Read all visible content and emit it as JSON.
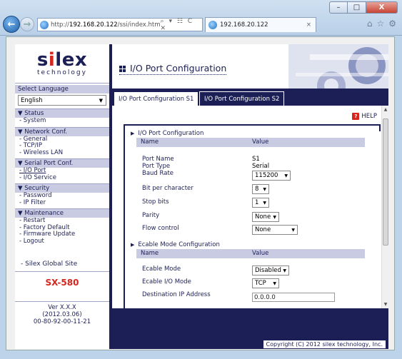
{
  "browser": {
    "url_prefix": "http://",
    "url_host": "192.168.20.122",
    "url_path": "/ssi/index.htm",
    "address_tools": "⌕ ▾ ☷ C ✕",
    "tab_title": "192.168.20.122",
    "tab_close": "×",
    "back": "←",
    "forward": "→",
    "min": "–",
    "max": "□",
    "close": "X",
    "icons": [
      "home-icon",
      "star-icon",
      "gear-icon"
    ]
  },
  "logo": {
    "main_pre": "s",
    "main_i": "i",
    "main_post": "lex",
    "sub": "technology"
  },
  "nav": {
    "language_title": "Select Language",
    "language_value": "English",
    "groups": [
      {
        "title": "▼ Status",
        "items": [
          "- System"
        ]
      },
      {
        "title": "▼ Network Conf.",
        "items": [
          "- General",
          "- TCP/IP",
          "- Wireless LAN"
        ]
      },
      {
        "title": "▼ Serial Port Conf.",
        "items": [
          "- I/O Port",
          "- I/O Service"
        ]
      },
      {
        "title": "▼ Security",
        "items": [
          "- Password",
          "- IP Filter"
        ]
      },
      {
        "title": "▼ Maintenance",
        "items": [
          "- Restart",
          "- Factory Default",
          "- Firmware Update",
          "- Logout"
        ]
      }
    ],
    "global_site": "- Silex Global Site",
    "model": "SX-580",
    "version_lines": [
      "Ver X.X.X",
      "(2012.03.06)",
      "00-80-92-00-11-21"
    ]
  },
  "main": {
    "title": "I/O Port Configuration",
    "tabs": [
      "I/O Port Configuration S1",
      "I/O Port Configuration S2"
    ],
    "help": "HELP",
    "section1": {
      "heading": "I/O Port Configuration",
      "col_name": "Name",
      "col_value": "Value",
      "port_name_label": "Port Name",
      "port_name_value": "S1",
      "port_type_label": "Port Type",
      "port_type_value": "Serial",
      "baud_label": "Baud Rate",
      "baud_value": "115200",
      "bits_label": "Bit per character",
      "bits_value": "8",
      "stop_label": "Stop bits",
      "stop_value": "1",
      "parity_label": "Parity",
      "parity_value": "None",
      "flow_label": "Flow control",
      "flow_value": "None"
    },
    "section2": {
      "heading": "Ecable Mode Configuration",
      "col_name": "Name",
      "col_value": "Value",
      "mode_label": "Ecable Mode",
      "mode_value": "Disabled",
      "io_label": "Ecable I/O Mode",
      "io_value": "TCP",
      "dest_label": "Destination IP Address",
      "dest_value": "0.0.0.0"
    },
    "copyright": "Copyright (C) 2012 silex technology, Inc."
  }
}
